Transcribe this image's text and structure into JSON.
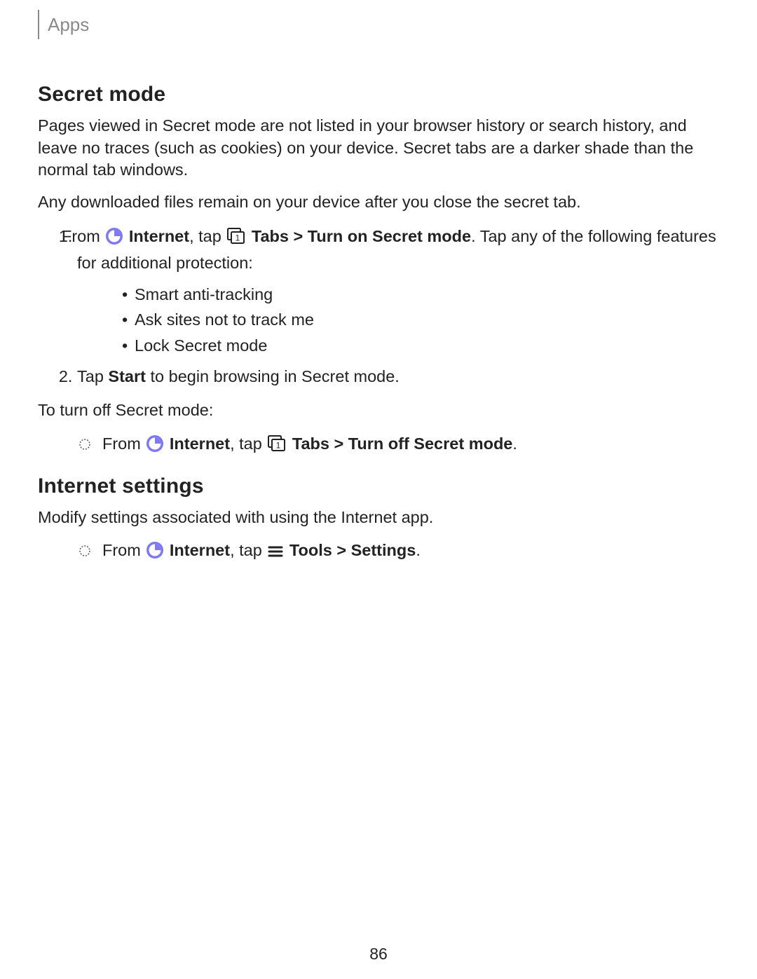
{
  "breadcrumb": "Apps",
  "secretMode": {
    "heading": "Secret mode",
    "p1": "Pages viewed in Secret mode are not listed in your browser history or search history, and leave no traces (such as cookies) on your device. Secret tabs are a darker shade than the normal tab windows.",
    "p2": "Any downloaded files remain on your device after you close the secret tab.",
    "step1": {
      "pre": "From ",
      "internet": "Internet",
      "mid": ", tap ",
      "tabs": "Tabs",
      "sep": " > ",
      "turnOn": "Turn on Secret mode",
      "post": ". Tap any of the following features for additional protection:",
      "bullets": {
        "b1": "Smart anti-tracking",
        "b2": "Ask sites not to track me",
        "b3": "Lock Secret mode"
      }
    },
    "step2": {
      "pre": "Tap ",
      "start": "Start",
      "post": " to begin browsing in Secret mode."
    },
    "turnOffIntro": "To turn off Secret mode:",
    "turnOff": {
      "pre": "From ",
      "internet": "Internet",
      "mid": ", tap ",
      "tabs": "Tabs",
      "sep": " > ",
      "turnOff": "Turn off Secret mode",
      "post": "."
    }
  },
  "internetSettings": {
    "heading": "Internet settings",
    "p1": "Modify settings associated with using the Internet app.",
    "step": {
      "pre": "From ",
      "internet": "Internet",
      "mid": ", tap ",
      "tools": "Tools",
      "sep": " > ",
      "settings": "Settings",
      "post": "."
    }
  },
  "pageNumber": "86"
}
